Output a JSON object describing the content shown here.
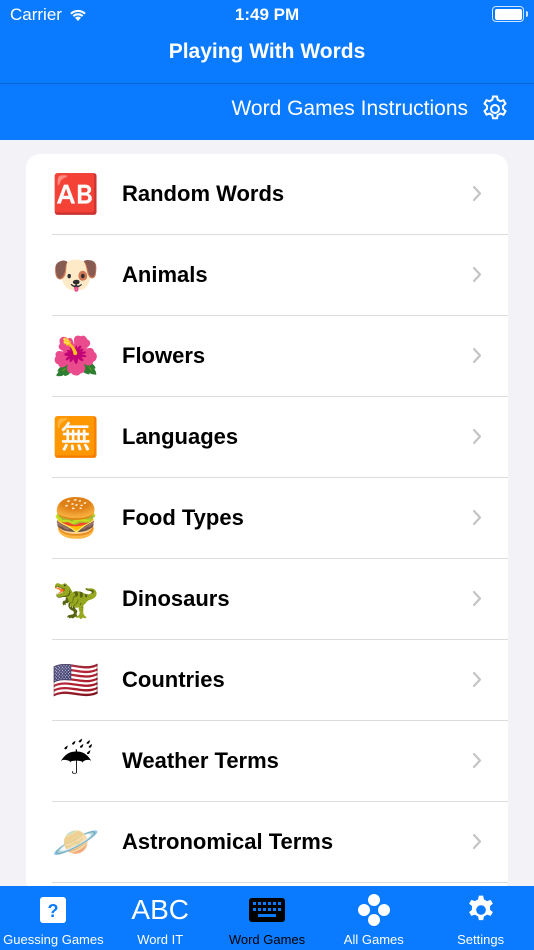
{
  "status_bar": {
    "carrier": "Carrier",
    "time": "1:49 PM"
  },
  "header": {
    "title": "Playing With Words",
    "instructions_label": "Word Games Instructions"
  },
  "list": [
    {
      "label": "Random Words",
      "icon": "ab-button-icon",
      "glyph": "🆎"
    },
    {
      "label": "Animals",
      "icon": "dog-face-icon",
      "glyph": "🐶"
    },
    {
      "label": "Flowers",
      "icon": "hibiscus-icon",
      "glyph": "🌺"
    },
    {
      "label": "Languages",
      "icon": "japanese-vacancy-icon",
      "glyph": "🈚"
    },
    {
      "label": "Food Types",
      "icon": "hamburger-icon",
      "glyph": "🍔"
    },
    {
      "label": "Dinosaurs",
      "icon": "t-rex-icon",
      "glyph": "🦖"
    },
    {
      "label": "Countries",
      "icon": "us-flag-icon",
      "glyph": "🇺🇸"
    },
    {
      "label": "Weather Terms",
      "icon": "umbrella-rain-icon",
      "glyph": "☔"
    },
    {
      "label": "Astronomical Terms",
      "icon": "ringed-planet-icon",
      "glyph": "🪐"
    }
  ],
  "tabs": [
    {
      "label": "Guessing Games",
      "icon": "question-mark-icon",
      "active": false
    },
    {
      "label": "Word IT",
      "icon": "abc-icon",
      "icon_text": "ABC",
      "active": false
    },
    {
      "label": "Word Games",
      "icon": "keyboard-icon",
      "active": true
    },
    {
      "label": "All Games",
      "icon": "game-controller-icon",
      "active": false
    },
    {
      "label": "Settings",
      "icon": "gear-icon",
      "active": false
    }
  ],
  "colors": {
    "accent": "#0a7afe",
    "background": "#f2f2f7",
    "chevron": "#c4c4c7"
  }
}
